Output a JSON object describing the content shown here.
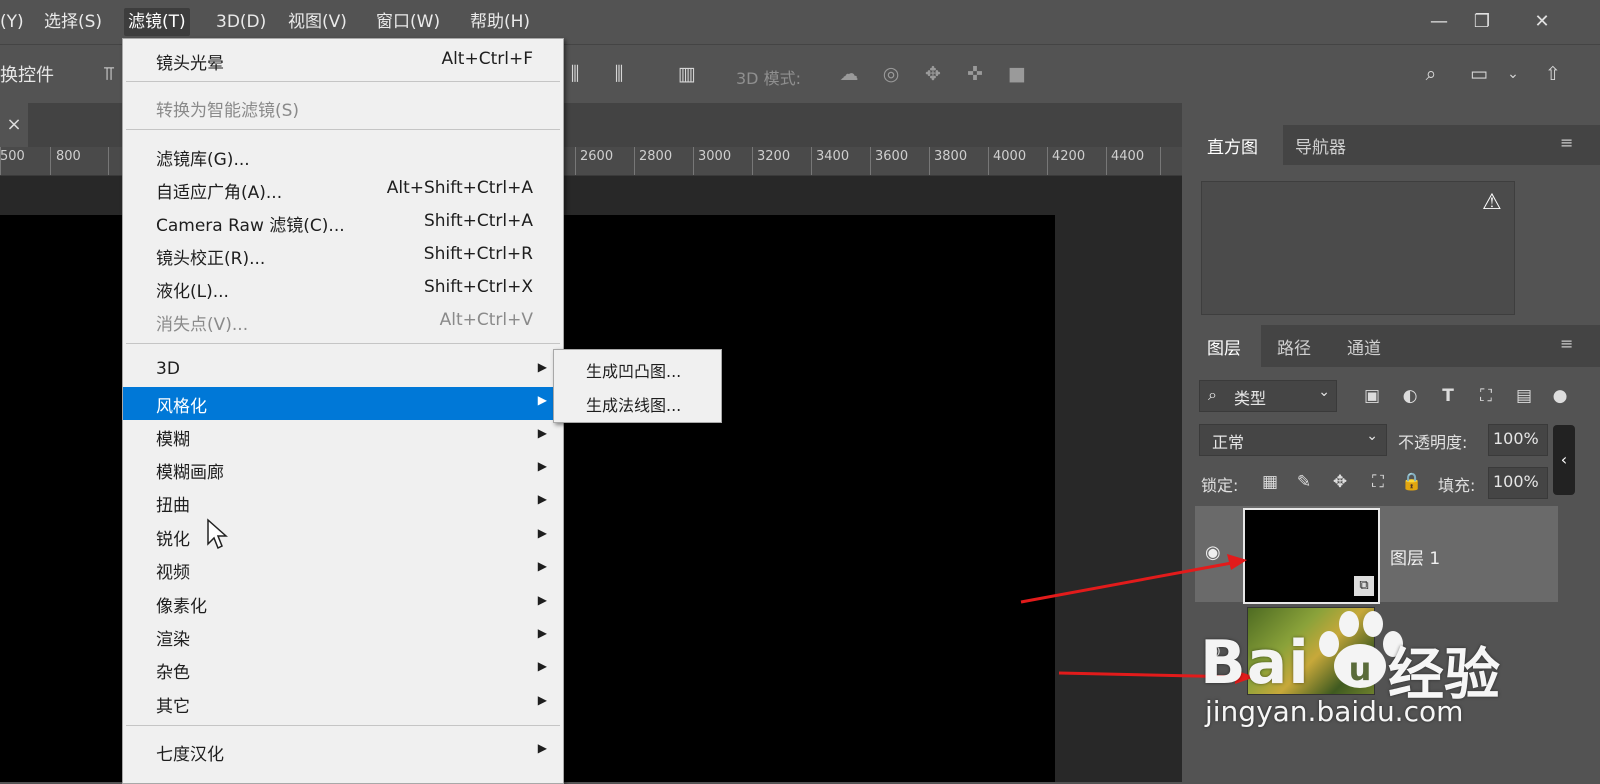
{
  "menubar": {
    "items": [
      "(Y)",
      "选择(S)",
      "滤镜(T)",
      "3D(D)",
      "视图(V)",
      "窗口(W)",
      "帮助(H)"
    ],
    "active_index": 2,
    "win_min": "—",
    "win_restore": "❐",
    "win_close": "✕"
  },
  "optbar": {
    "left_label": "换控件",
    "mode_label": "3D 模式:"
  },
  "doc_tab": {
    "close": "×"
  },
  "ruler": {
    "ticks": [
      "500",
      "800",
      "2600",
      "2800",
      "3000",
      "3200",
      "3400",
      "3600",
      "3800",
      "4000",
      "4200",
      "4400"
    ]
  },
  "filter_menu": {
    "items": [
      {
        "label": "镜头光晕",
        "shortcut": "Alt+Ctrl+F",
        "state": "normal"
      },
      {
        "label": "转换为智能滤镜(S)",
        "shortcut": "",
        "state": "disabled"
      },
      {
        "label": "滤镜库(G)...",
        "shortcut": "",
        "state": "normal"
      },
      {
        "label": "自适应广角(A)...",
        "shortcut": "Alt+Shift+Ctrl+A",
        "state": "normal"
      },
      {
        "label": "Camera Raw 滤镜(C)...",
        "shortcut": "Shift+Ctrl+A",
        "state": "normal"
      },
      {
        "label": "镜头校正(R)...",
        "shortcut": "Shift+Ctrl+R",
        "state": "normal"
      },
      {
        "label": "液化(L)...",
        "shortcut": "Shift+Ctrl+X",
        "state": "normal"
      },
      {
        "label": "消失点(V)...",
        "shortcut": "Alt+Ctrl+V",
        "state": "disabled"
      },
      {
        "label": "3D",
        "shortcut": "",
        "state": "submenu"
      },
      {
        "label": "风格化",
        "shortcut": "",
        "state": "highlight"
      },
      {
        "label": "模糊",
        "shortcut": "",
        "state": "submenu"
      },
      {
        "label": "模糊画廊",
        "shortcut": "",
        "state": "submenu"
      },
      {
        "label": "扭曲",
        "shortcut": "",
        "state": "submenu"
      },
      {
        "label": "锐化",
        "shortcut": "",
        "state": "submenu"
      },
      {
        "label": "视频",
        "shortcut": "",
        "state": "submenu"
      },
      {
        "label": "像素化",
        "shortcut": "",
        "state": "submenu"
      },
      {
        "label": "渲染",
        "shortcut": "",
        "state": "submenu"
      },
      {
        "label": "杂色",
        "shortcut": "",
        "state": "submenu"
      },
      {
        "label": "其它",
        "shortcut": "",
        "state": "submenu"
      },
      {
        "label": "七度汉化",
        "shortcut": "",
        "state": "submenu"
      }
    ],
    "arrow": "▶"
  },
  "submenu": {
    "items": [
      "生成凹凸图...",
      "生成法线图..."
    ]
  },
  "panels": {
    "histogram_tab": "直方图",
    "navigator_tab": "导航器",
    "warning": "⚠",
    "layers_tab": "图层",
    "paths_tab": "路径",
    "channels_tab": "通道",
    "filter_kind": "类型",
    "filter_kind_prefix": "⌕",
    "blend_mode": "正常",
    "opacity_label": "不透明度:",
    "opacity_value": "100%",
    "lock_label": "锁定:",
    "fill_label": "填充:",
    "fill_value": "100%",
    "layer1_name": "图层 1",
    "eye": "👁"
  },
  "watermark": {
    "logo": "Bai",
    "logo_tail": "u",
    "product": "经验",
    "url": "jingyan.baidu.com"
  },
  "colors": {
    "menu_highlight": "#0078d7",
    "arrow_red": "#e21b1b"
  }
}
